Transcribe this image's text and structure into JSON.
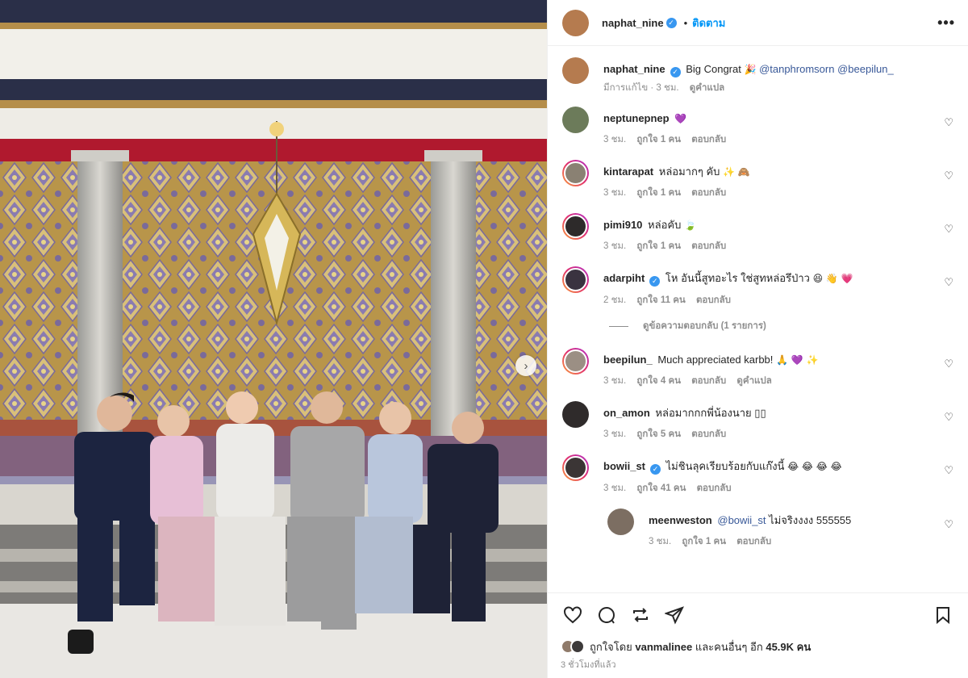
{
  "post": {
    "author": "naphat_nine",
    "follow_label": "ติดตาม",
    "dot": "•",
    "more_label": "•••"
  },
  "caption": {
    "username": "naphat_nine",
    "text": "Big Congrat",
    "emoji": "🎉",
    "mention1": "@tanphromsorn",
    "mention2": "@beepilun_",
    "meta": "มีการแก้ไข · 3 ชม.",
    "translate_label": "ดูคำแปล"
  },
  "comments": [
    {
      "username": "neptunepnep",
      "verified": false,
      "text": "",
      "emoji": "💜",
      "time": "3 ชม.",
      "likes": "ถูกใจ 1 คน",
      "reply": "ตอบกลับ",
      "avatar_color": "#6c7b5a",
      "ring": false
    },
    {
      "username": "kintarapat",
      "verified": false,
      "text": "หล่อมากๆ คับ",
      "emoji": "✨ 🙈",
      "time": "3 ชม.",
      "likes": "ถูกใจ 1 คน",
      "reply": "ตอบกลับ",
      "avatar_color": "#8a8173",
      "ring": true
    },
    {
      "username": "pimi910",
      "verified": false,
      "text": "หล่อคับ",
      "emoji": "🍃",
      "time": "3 ชม.",
      "likes": "ถูกใจ 1 คน",
      "reply": "ตอบกลับ",
      "avatar_color": "#2d2a2a",
      "ring": true
    },
    {
      "username": "adarpiht",
      "verified": true,
      "text": "โห อันนี้สูทอะไร ใช่สูทหล่อรึป่าว",
      "emoji": "😆 👋 💗",
      "time": "2 ชม.",
      "likes": "ถูกใจ 11 คน",
      "reply": "ตอบกลับ",
      "avatar_color": "#3a3340",
      "ring": true
    }
  ],
  "view_replies_label": "ดูข้อความตอบกลับ (1 รายการ)",
  "comments2": [
    {
      "username": "beepilun_",
      "verified": false,
      "text": "Much appreciated karbb!",
      "emoji": "🙏 💜 ✨",
      "time": "3 ชม.",
      "likes": "ถูกใจ 4 คน",
      "reply": "ตอบกลับ",
      "translate": "ดูคำแปล",
      "avatar_color": "#9b8f84",
      "ring": true
    },
    {
      "username": "on_amon",
      "verified": false,
      "text": "หล่อมากกกพี่น้องนาย",
      "emoji": "▯▯",
      "time": "3 ชม.",
      "likes": "ถูกใจ 5 คน",
      "reply": "ตอบกลับ",
      "avatar_color": "#2f2b2b",
      "ring": false
    },
    {
      "username": "bowii_st",
      "verified": true,
      "text": "ไม่ชินลุคเรียบร้อยกับแก๊งนี้",
      "emoji": "😂 😂 😂 😂",
      "time": "3 ชม.",
      "likes": "ถูกใจ 41 คน",
      "reply": "ตอบกลับ",
      "avatar_color": "#3b3535",
      "ring": true
    }
  ],
  "reply": {
    "username": "meenweston",
    "mention": "@bowii_st",
    "text": "ไม่จริงงงง 555555",
    "time": "3 ชม.",
    "likes": "ถูกใจ 1 คน",
    "reply": "ตอบกลับ",
    "avatar_color": "#7c6e62"
  },
  "footer": {
    "likes_prefix": "ถูกใจโดย",
    "liker": "vanmalinee",
    "likes_middle": "และคนอื่นๆ อีก",
    "likes_count": "45.9K",
    "likes_suffix": "คน",
    "time": "3 ชั่วโมงที่แล้ว"
  },
  "icons": {
    "like": "heart-icon",
    "comment": "comment-icon",
    "share": "repost-icon",
    "send": "send-icon",
    "save": "bookmark-icon",
    "next": "chevron-right-icon"
  },
  "colors": {
    "follow": "#0095f6",
    "verified": "#3897f0",
    "meta": "#8e8e8e"
  }
}
